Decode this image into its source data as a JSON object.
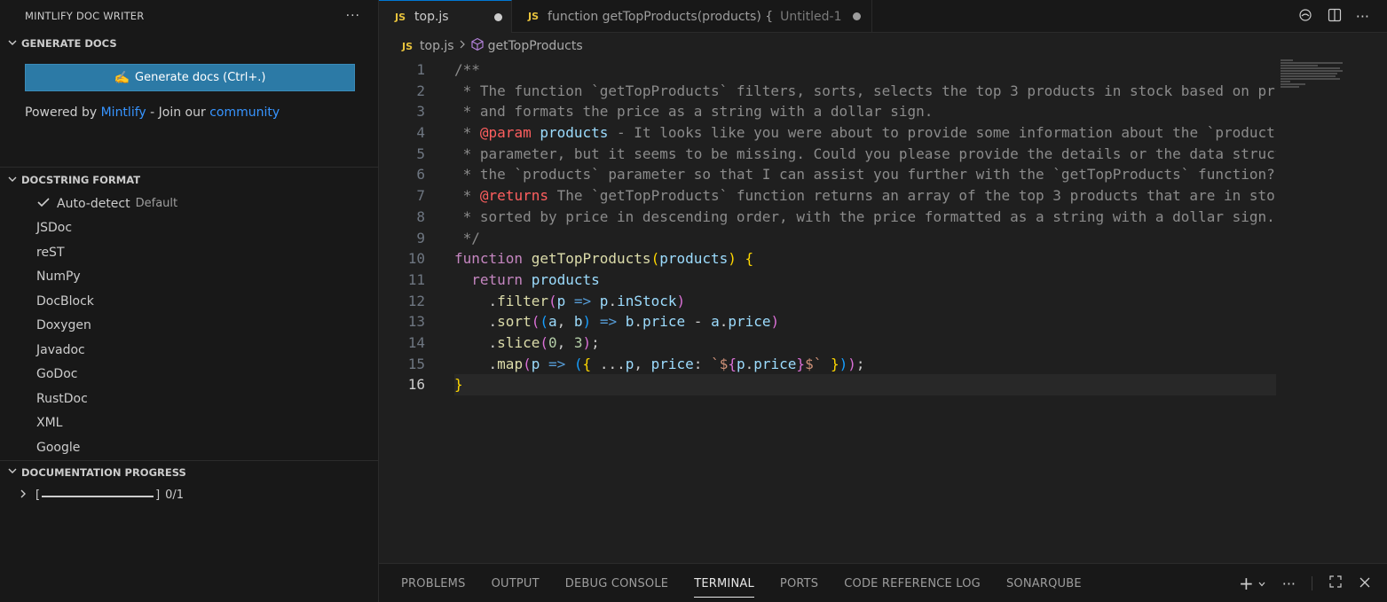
{
  "sidebar": {
    "title": "MINTLIFY DOC WRITER",
    "generate": {
      "heading": "GENERATE DOCS",
      "button_label": "Generate docs (Ctrl+.)",
      "button_emoji": "✍️",
      "powered_prefix": "Powered by ",
      "powered_link": "Mintlify",
      "join_text": " - Join our ",
      "community_link": "community"
    },
    "formats": {
      "heading": "DOCSTRING FORMAT",
      "selected": "Auto-detect",
      "selected_tag": "Default",
      "items": [
        "JSDoc",
        "reST",
        "NumPy",
        "DocBlock",
        "Doxygen",
        "Javadoc",
        "GoDoc",
        "RustDoc",
        "XML",
        "Google"
      ]
    },
    "progress": {
      "heading": "DOCUMENTATION PROGRESS",
      "bar_open": "[",
      "bar_close": "]",
      "count": "0/1",
      "fraction": 0
    }
  },
  "editor": {
    "tabs": [
      {
        "badge": "JS",
        "label": "top.js",
        "dirty": true
      },
      {
        "badge": "JS",
        "label": "function getTopProducts(products) {",
        "sub": "Untitled-1",
        "dirty": true
      }
    ],
    "breadcrumb": {
      "badge": "JS",
      "file": "top.js",
      "symbol": "getTopProducts"
    },
    "line_numbers": [
      "1",
      "2",
      "3",
      "4",
      "5",
      "6",
      "7",
      "8",
      "9",
      "10",
      "11",
      "12",
      "13",
      "14",
      "15",
      "16"
    ],
    "current_line": "16"
  },
  "panel": {
    "tabs": [
      "PROBLEMS",
      "OUTPUT",
      "DEBUG CONSOLE",
      "TERMINAL",
      "PORTS",
      "CODE REFERENCE LOG",
      "SONARQUBE"
    ],
    "active_tab": "TERMINAL"
  },
  "code": {
    "l1": "/**",
    "l2": " * The function `getTopProducts` filters, sorts, selects the top 3 products in stock based on price,",
    "l3": " * and formats the price as a string with a dollar sign.",
    "l4_star": " * ",
    "l4_tag": "@param",
    "l4_name": " products",
    "l4_rest": " - It looks like you were about to provide some information about the `products`",
    "l5": " * parameter, but it seems to be missing. Could you please provide the details or the data structure of",
    "l6": " * the `products` parameter so that I can assist you further with the `getTopProducts` function?",
    "l7_star": " * ",
    "l7_tag": "@returns",
    "l7_rest": " The `getTopProducts` function returns an array of the top 3 products that are in stock,",
    "l8": " * sorted by price in descending order, with the price formatted as a string with a dollar sign.",
    "l9": " */",
    "kw_function": "function",
    "fn_name": "getTopProducts",
    "param": "products",
    "kw_return": "return",
    "m_filter": "filter",
    "m_sort": "sort",
    "m_slice": "slice",
    "m_map": "map",
    "v_p": "p",
    "v_a": "a",
    "v_b": "b",
    "prop_inStock": "inStock",
    "prop_price": "price",
    "n0": "0",
    "n3": "3"
  },
  "icons": {
    "more": "more-icon",
    "chevron_down": "chevron-down-icon",
    "chevron_right": "chevron-right-icon",
    "check": "check-icon",
    "symbol": "method-symbol-icon"
  }
}
